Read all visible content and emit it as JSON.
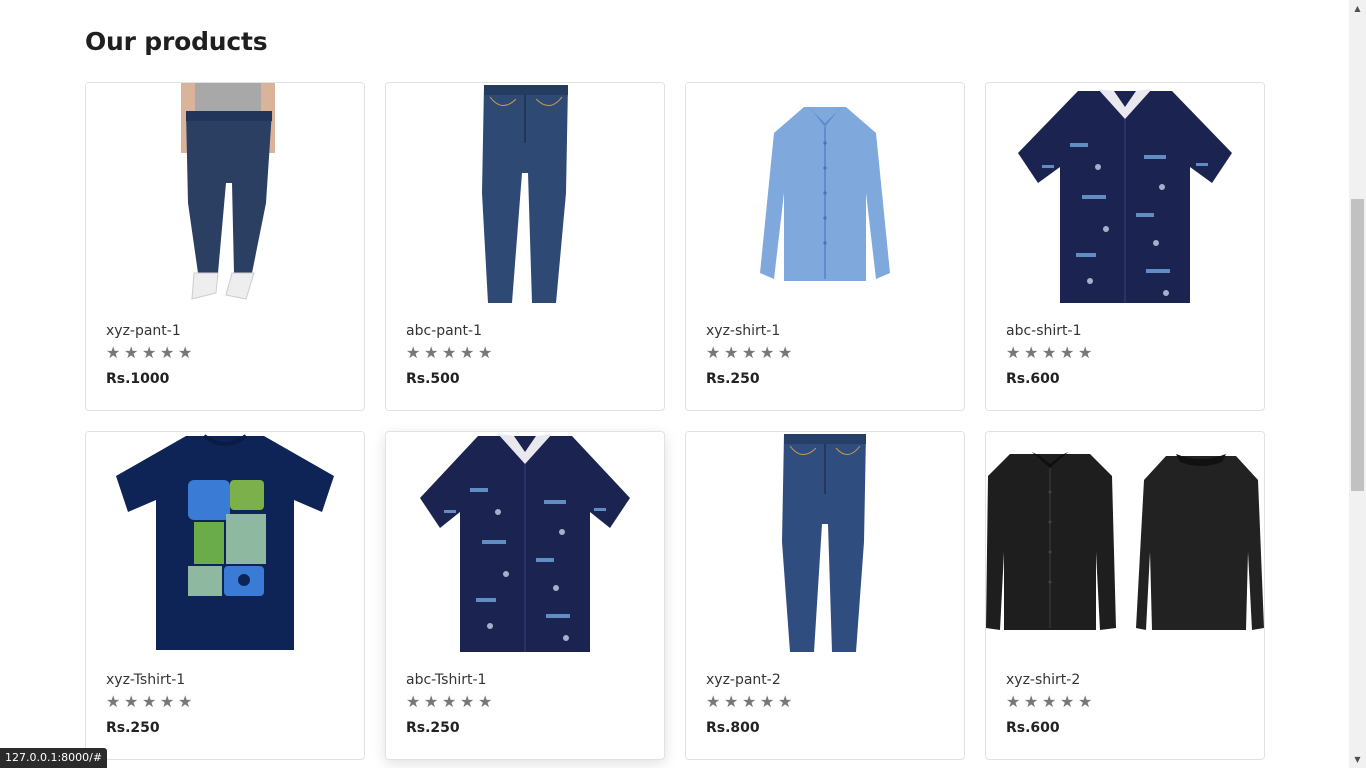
{
  "section": {
    "title": "Our products"
  },
  "products": [
    {
      "name": "xyz-pant-1",
      "price": "Rs.1000",
      "image": "jeans-model"
    },
    {
      "name": "abc-pant-1",
      "price": "Rs.500",
      "image": "jeans"
    },
    {
      "name": "xyz-shirt-1",
      "price": "Rs.250",
      "image": "light-blue-shirt"
    },
    {
      "name": "abc-shirt-1",
      "price": "Rs.600",
      "image": "navy-print-shirt"
    },
    {
      "name": "xyz-Tshirt-1",
      "price": "Rs.250",
      "image": "navy-graphic-tshirt"
    },
    {
      "name": "abc-Tshirt-1",
      "price": "Rs.250",
      "image": "navy-print-shirt"
    },
    {
      "name": "xyz-pant-2",
      "price": "Rs.800",
      "image": "jeans"
    },
    {
      "name": "xyz-shirt-2",
      "price": "Rs.600",
      "image": "black-shirt-front-back"
    }
  ],
  "rating_star_glyph": "★",
  "status_url": "127.0.0.1:8000/#",
  "colors": {
    "star": "#777777",
    "card_border": "#e2e2e2",
    "denim": "#2c4a78",
    "navy": "#1b2350"
  }
}
